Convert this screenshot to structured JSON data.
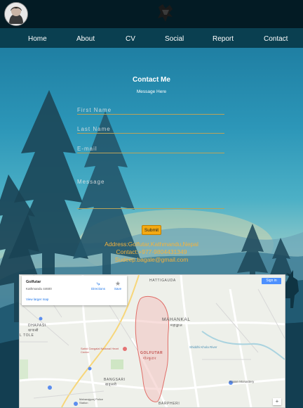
{
  "nav": {
    "items": [
      {
        "label": "Home"
      },
      {
        "label": "About"
      },
      {
        "label": "CV"
      },
      {
        "label": "Social"
      },
      {
        "label": "Report"
      },
      {
        "label": "Contact"
      }
    ]
  },
  "contact": {
    "title": "Contact Me",
    "subtitle": "Message Here",
    "first_name_placeholder": "First Name",
    "last_name_placeholder": "Last Name",
    "email_placeholder": "E-mail",
    "message_placeholder": "Message",
    "submit_label": "Submit"
  },
  "info": {
    "address": "Address:Golfutar,Kathmandu,Nepal",
    "contact": "Contact:+977-9804431349",
    "email": "Sudeep.bagale@gmail.com"
  },
  "map": {
    "place_name": "Golfutar",
    "place_address": "Kathmandu 44600",
    "directions_label": "Directions",
    "save_label": "Save",
    "larger_map_link": "View larger map",
    "sign_in_label": "Sign in",
    "labels": {
      "hattigauda": "HATTIGAUDA",
      "mahankal": "MAHANKAL",
      "mahankal_np": "महाङ्काल",
      "golfutar": "GOLFUTAR",
      "golfutar_np": "गोल्फुटार",
      "dhapasi": "DHAPASI",
      "dhapasi_np": "धापासी",
      "l_tole": "L TOLE",
      "bangsari": "BANGSARI",
      "bangsari_np": "बाङ्सरी",
      "barpheri": "BARPHERI",
      "heart_center": "Sahid Gangalal National Heart Center",
      "kopan": "Kopan Monastery",
      "police": "Maharajgunj Police Station",
      "shukla_road": "Shiddhi Khola River"
    },
    "accent_area_color": "#e88b86"
  },
  "colors": {
    "accent_text": "#f4b23c",
    "submit_bg": "#f3a912",
    "topbar": "#031b24",
    "nav": "#0a3f50"
  }
}
